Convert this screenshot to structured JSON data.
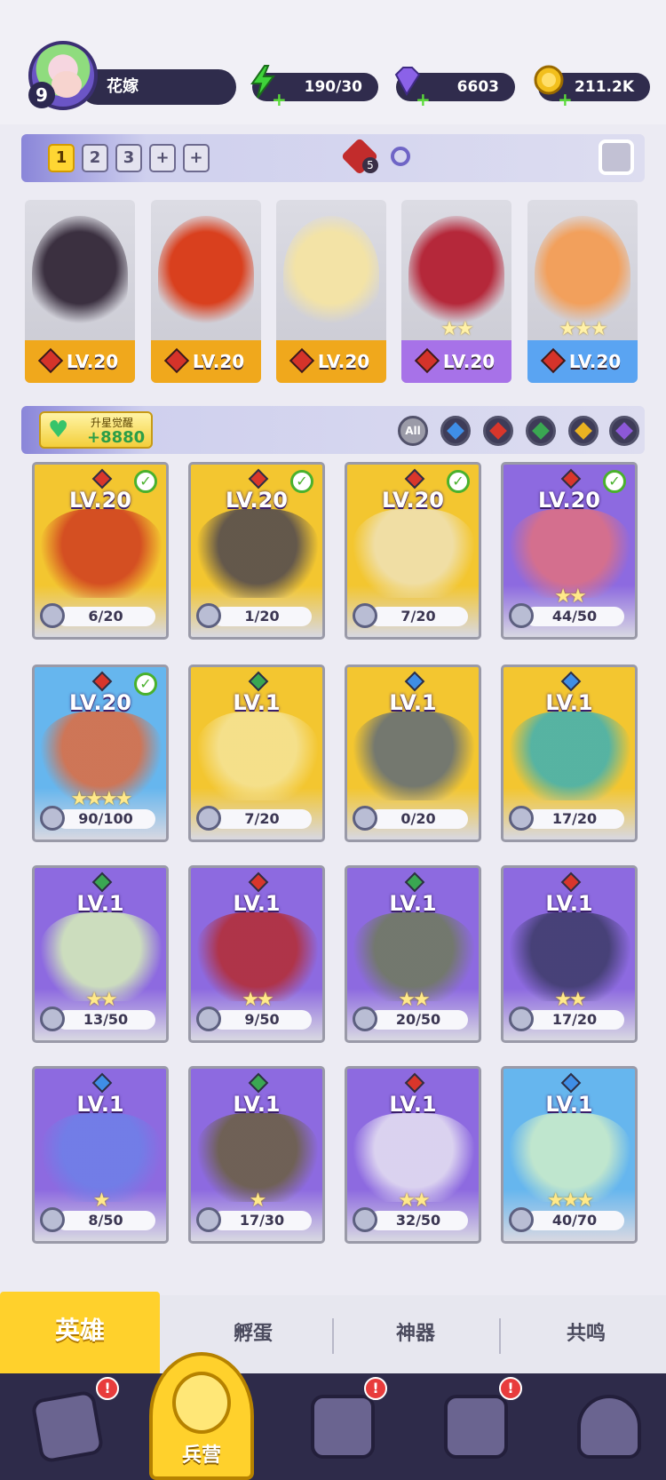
{
  "player": {
    "level": "9",
    "name": "花嫁"
  },
  "resources": [
    {
      "icon": "energy-icon",
      "value": "190/30",
      "color": "#3fd43a"
    },
    {
      "icon": "gem-icon",
      "value": "6603",
      "color": "#8b62e8"
    },
    {
      "icon": "coin-icon",
      "value": "211.2K",
      "color": "#f2bf1c"
    }
  ],
  "team": {
    "slots": [
      "1",
      "2",
      "3",
      "+",
      "+"
    ],
    "active_slot": "1",
    "rank_count": "5"
  },
  "lineup": [
    {
      "level": "LV.20",
      "stars": "",
      "base_color": "#f0a81c",
      "art_color": "#3b3040"
    },
    {
      "level": "LV.20",
      "stars": "",
      "base_color": "#f0a81c",
      "art_color": "#d9401e"
    },
    {
      "level": "LV.20",
      "stars": "",
      "base_color": "#f0a81c",
      "art_color": "#f3e3a6"
    },
    {
      "level": "LV.20",
      "stars": "★★",
      "base_color": "#a772e8",
      "art_color": "#b5283a"
    },
    {
      "level": "LV.20",
      "stars": "★★★",
      "base_color": "#5aa4f2",
      "art_color": "#f2a05c"
    }
  ],
  "awaken": {
    "title": "升星觉醒",
    "value": "+8880"
  },
  "filters": [
    {
      "name": "filter-all",
      "label": "All",
      "gem": ""
    },
    {
      "name": "filter-water",
      "label": "",
      "gem": "#3f8ee6"
    },
    {
      "name": "filter-fire",
      "label": "",
      "gem": "#d9362b"
    },
    {
      "name": "filter-wind",
      "label": "",
      "gem": "#3aa752"
    },
    {
      "name": "filter-light",
      "label": "",
      "gem": "#eab321"
    },
    {
      "name": "filter-dark",
      "label": "",
      "gem": "#8c58d8"
    }
  ],
  "heroes": [
    {
      "level": "LV.20",
      "stars": "",
      "shards": "6/20",
      "element": "#d9362b",
      "bg": "#f3c630",
      "art": "#cf3a1f",
      "checked": true
    },
    {
      "level": "LV.20",
      "stars": "",
      "shards": "1/20",
      "element": "#d9362b",
      "bg": "#f3c630",
      "art": "#4a4450",
      "checked": true
    },
    {
      "level": "LV.20",
      "stars": "",
      "shards": "7/20",
      "element": "#d9362b",
      "bg": "#f3c630",
      "art": "#efe2b8",
      "checked": true
    },
    {
      "level": "LV.20",
      "stars": "★★",
      "shards": "44/50",
      "element": "#d9362b",
      "bg": "#8d6ae0",
      "art": "#e07080",
      "checked": true
    },
    {
      "level": "LV.20",
      "stars": "★★★★",
      "shards": "90/100",
      "element": "#d9362b",
      "bg": "#66b6ee",
      "art": "#e06a3c",
      "checked": true
    },
    {
      "level": "LV.1",
      "stars": "",
      "shards": "7/20",
      "element": "#3aa752",
      "bg": "#f3c630",
      "art": "#f5e49a",
      "checked": false
    },
    {
      "level": "LV.1",
      "stars": "",
      "shards": "0/20",
      "element": "#3f8ee6",
      "bg": "#f3c630",
      "art": "#5d6a7a",
      "checked": false
    },
    {
      "level": "LV.1",
      "stars": "",
      "shards": "17/20",
      "element": "#3f8ee6",
      "bg": "#f3c630",
      "art": "#3bb0b6",
      "checked": false
    },
    {
      "level": "LV.1",
      "stars": "★★",
      "shards": "13/50",
      "element": "#3aa752",
      "bg": "#8d6ae0",
      "art": "#d7f1b8",
      "checked": false
    },
    {
      "level": "LV.1",
      "stars": "★★",
      "shards": "9/50",
      "element": "#d9362b",
      "bg": "#8d6ae0",
      "art": "#b52a2e",
      "checked": false
    },
    {
      "level": "LV.1",
      "stars": "★★",
      "shards": "20/50",
      "element": "#3aa752",
      "bg": "#8d6ae0",
      "art": "#6e7a5a",
      "checked": false
    },
    {
      "level": "LV.1",
      "stars": "★★",
      "shards": "17/20",
      "element": "#d9362b",
      "bg": "#8d6ae0",
      "art": "#3b3a66",
      "checked": false
    },
    {
      "level": "LV.1",
      "stars": "★",
      "shards": "8/50",
      "element": "#3f8ee6",
      "bg": "#8d6ae0",
      "art": "#6d80e8",
      "checked": false
    },
    {
      "level": "LV.1",
      "stars": "★",
      "shards": "17/30",
      "element": "#3aa752",
      "bg": "#8d6ae0",
      "art": "#6a5f3e",
      "checked": false
    },
    {
      "level": "LV.1",
      "stars": "★★",
      "shards": "32/50",
      "element": "#d9362b",
      "bg": "#8d6ae0",
      "art": "#e8e4f2",
      "checked": false
    },
    {
      "level": "LV.1",
      "stars": "★★★",
      "shards": "40/70",
      "element": "#3f8ee6",
      "bg": "#66b6ee",
      "art": "#cfeec8",
      "checked": false
    }
  ],
  "subtabs": [
    "英雄",
    "孵蛋",
    "神器",
    "共鸣"
  ],
  "nav": {
    "active_label": "兵营"
  }
}
